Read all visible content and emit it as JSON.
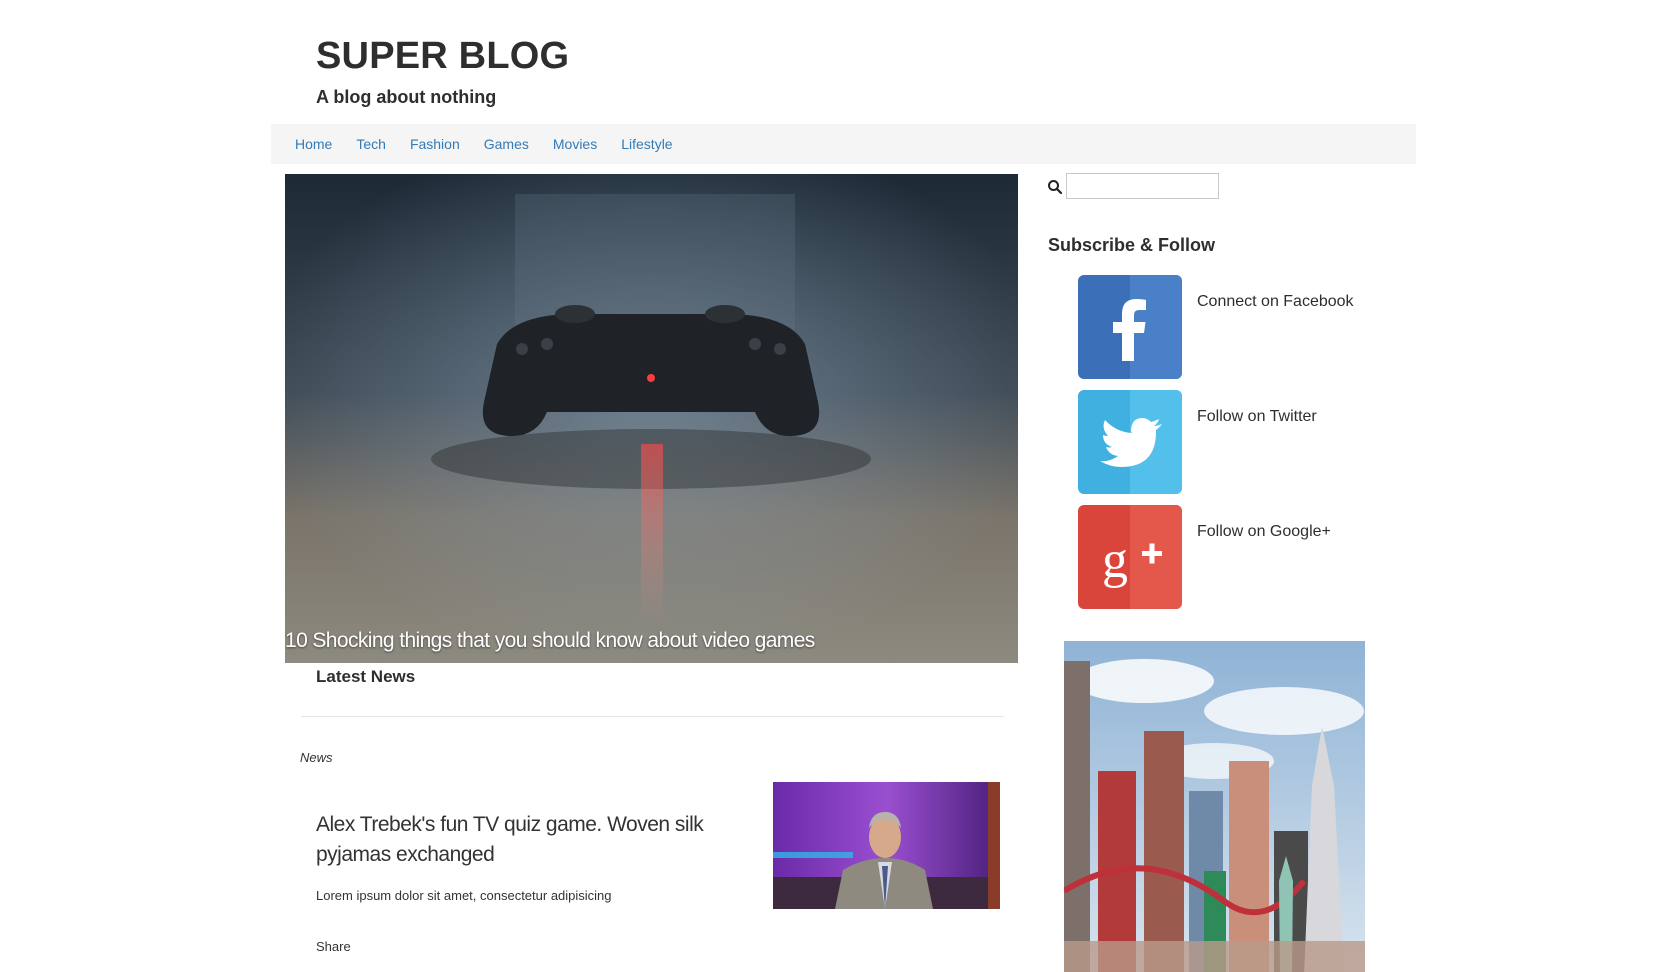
{
  "site": {
    "title": "SUPER BLOG",
    "tagline": "A blog about nothing"
  },
  "nav": {
    "items": [
      {
        "label": "Home"
      },
      {
        "label": "Tech"
      },
      {
        "label": "Fashion"
      },
      {
        "label": "Games"
      },
      {
        "label": "Movies"
      },
      {
        "label": "Lifestyle"
      }
    ]
  },
  "hero": {
    "caption": "10 Shocking things that you should know about video games",
    "image": "game-controller-photo"
  },
  "latest": {
    "heading": "Latest News",
    "article": {
      "category": "News",
      "title": "Alex Trebek's fun TV quiz game. Woven silk pyjamas exchanged",
      "excerpt": "Lorem ipsum dolor sit amet, consectetur adipisicing",
      "share_label": "Share",
      "image": "tv-host-photo"
    }
  },
  "sidebar": {
    "search": {
      "placeholder": "",
      "value": "",
      "icon": "search-icon"
    },
    "subscribe_heading": "Subscribe & Follow",
    "social": [
      {
        "label": "Connect on Facebook",
        "icon": "facebook-icon",
        "color": "#3b6fb8"
      },
      {
        "label": "Follow on Twitter",
        "icon": "twitter-icon",
        "color": "#45b5e2"
      },
      {
        "label": "Follow on Google+",
        "icon": "google-plus-icon",
        "color": "#d9453a"
      }
    ],
    "ad_image": "city-skyline-photo"
  },
  "colors": {
    "link": "#337ab7",
    "nav_background": "#f5f5f5",
    "text": "#333333"
  }
}
